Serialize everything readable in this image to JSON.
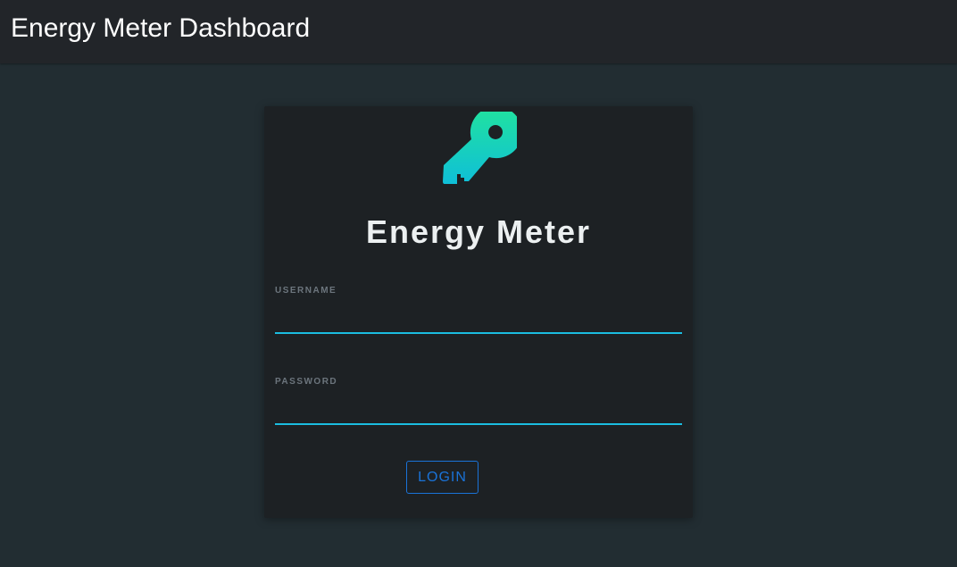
{
  "header": {
    "title": "Energy Meter Dashboard"
  },
  "login": {
    "icon": "key-icon",
    "title": "Energy Meter",
    "username": {
      "label": "USERNAME",
      "value": ""
    },
    "password": {
      "label": "PASSWORD",
      "value": ""
    },
    "login_button": "LOGIN"
  },
  "colors": {
    "page_background": "#222d32",
    "topbar_background": "#222529",
    "card_background": "#1d2124",
    "input_underline": "#1bbde0",
    "button_accent": "#1a73d8",
    "icon_gradient_top": "#21e39e",
    "icon_gradient_bottom": "#0fbfd8"
  }
}
